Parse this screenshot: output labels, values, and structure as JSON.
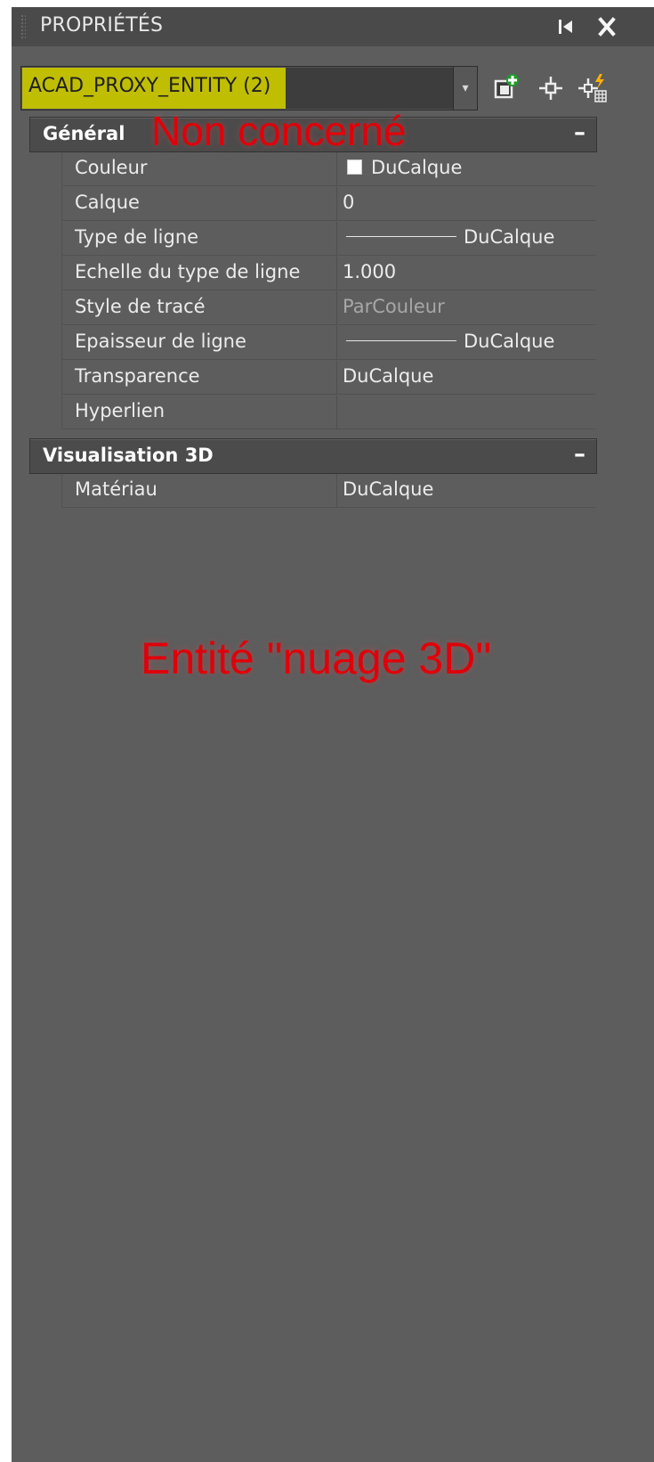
{
  "panel": {
    "title": "PROPRIÉTÉS",
    "titlebar_icons": [
      "pin-icon",
      "close-icon"
    ]
  },
  "selector": {
    "selected": "ACAD_PROXY_ENTITY (2)",
    "highlight_color": "#c7c500",
    "tool_icons": [
      "quick-select-icon",
      "select-objects-icon",
      "toggle-pickadd-icon"
    ]
  },
  "sections": [
    {
      "title": "Général",
      "toggle": "–",
      "properties": [
        {
          "name": "Couleur",
          "value": "DuCalque"
        },
        {
          "name": "Calque",
          "value": "0"
        },
        {
          "name": "Type de ligne",
          "value": "DuCalque"
        },
        {
          "name": "Echelle du type de ligne",
          "value": "1.000"
        },
        {
          "name": "Style de tracé",
          "value": "ParCouleur"
        },
        {
          "name": "Epaisseur de ligne",
          "value": "DuCalque"
        },
        {
          "name": "Transparence",
          "value": "DuCalque"
        },
        {
          "name": "Hyperlien",
          "value": ""
        }
      ]
    },
    {
      "title": "Visualisation 3D",
      "toggle": "–",
      "properties": [
        {
          "name": "Matériau",
          "value": "DuCalque"
        }
      ]
    }
  ],
  "annotations": {
    "general": "Non concerné",
    "entity": "Entité \"nuage 3D\"",
    "color": "#e0000a"
  },
  "colors": {
    "panel_bg": "#5d5d5d",
    "titlebar_bg": "#4a4a4a",
    "section_bg": "#4b4b4b"
  }
}
